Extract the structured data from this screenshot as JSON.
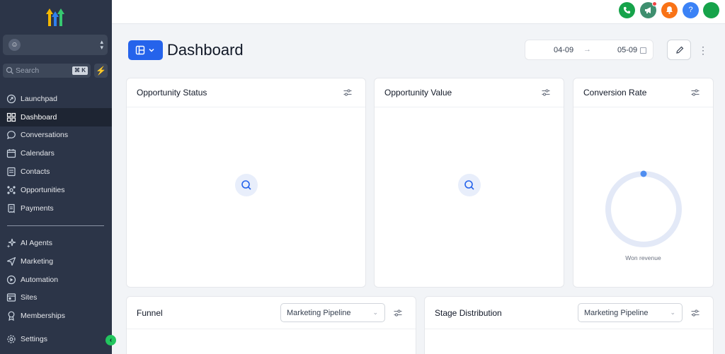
{
  "app": {
    "title": "Dashboard"
  },
  "sidebar": {
    "account_name": "",
    "search": {
      "placeholder": "Search",
      "shortcut": "⌘ K"
    },
    "items_primary": [
      {
        "label": "Launchpad",
        "icon": "launchpad-icon",
        "active": false
      },
      {
        "label": "Dashboard",
        "icon": "dashboard-icon",
        "active": true
      },
      {
        "label": "Conversations",
        "icon": "chat-icon",
        "active": false
      },
      {
        "label": "Calendars",
        "icon": "calendar-icon",
        "active": false
      },
      {
        "label": "Contacts",
        "icon": "contacts-icon",
        "active": false
      },
      {
        "label": "Opportunities",
        "icon": "opportunities-icon",
        "active": false
      },
      {
        "label": "Payments",
        "icon": "payments-icon",
        "active": false
      }
    ],
    "items_secondary": [
      {
        "label": "AI Agents",
        "icon": "sparkle-icon"
      },
      {
        "label": "Marketing",
        "icon": "send-icon"
      },
      {
        "label": "Automation",
        "icon": "automation-icon"
      },
      {
        "label": "Sites",
        "icon": "sites-icon"
      },
      {
        "label": "Memberships",
        "icon": "award-icon"
      }
    ],
    "settings_label": "Settings"
  },
  "topbar": {
    "buttons": [
      {
        "name": "phone-button",
        "icon": "phone-icon",
        "color": "#16a34a"
      },
      {
        "name": "announcements-button",
        "icon": "megaphone-icon",
        "color": "#3f8f6f"
      },
      {
        "name": "notifications-button",
        "icon": "bell-icon",
        "color": "#f97316"
      },
      {
        "name": "help-button",
        "icon": "help-icon",
        "color": "#3b82f6",
        "text": "?"
      },
      {
        "name": "profile-avatar",
        "icon": "avatar-icon",
        "color": "#16a34a"
      }
    ]
  },
  "header": {
    "date_start": "04-09",
    "date_arrow": "→",
    "date_end": "05-09"
  },
  "cards": {
    "opportunity_status": {
      "title": "Opportunity Status"
    },
    "opportunity_value": {
      "title": "Opportunity Value"
    },
    "conversion_rate": {
      "title": "Conversion Rate",
      "caption": "Won revenue"
    },
    "funnel": {
      "title": "Funnel",
      "pipeline": "Marketing Pipeline"
    },
    "stage_distribution": {
      "title": "Stage Distribution",
      "pipeline": "Marketing Pipeline"
    }
  },
  "colors": {
    "sidebar_bg": "#2c3548",
    "accent": "#2563eb",
    "success": "#22c55e"
  }
}
